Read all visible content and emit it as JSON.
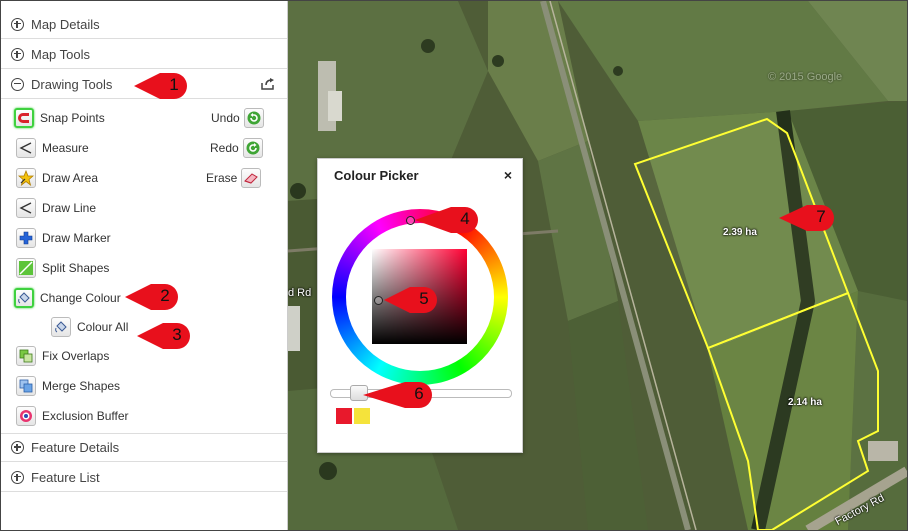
{
  "sidebar": {
    "sections": {
      "map_details": "Map Details",
      "map_tools": "Map Tools",
      "drawing_tools": "Drawing Tools",
      "feature_details": "Feature Details",
      "feature_list": "Feature List"
    },
    "tools": {
      "snap_points": "Snap Points",
      "measure": "Measure",
      "draw_area": "Draw Area",
      "draw_line": "Draw Line",
      "draw_marker": "Draw Marker",
      "split_shapes": "Split Shapes",
      "change_colour": "Change Colour",
      "colour_all": "Colour All",
      "fix_overlaps": "Fix Overlaps",
      "merge_shapes": "Merge Shapes",
      "exclusion_buffer": "Exclusion Buffer",
      "undo": "Undo",
      "redo": "Redo",
      "erase": "Erase"
    }
  },
  "map": {
    "area_labels": [
      "2.39 ha",
      "2.14 ha"
    ],
    "road_labels": {
      "factory": "Factory Rd",
      "left": "d Rd"
    },
    "watermark": "© 2015 Google"
  },
  "picker": {
    "title": "Colour Picker",
    "close": "×",
    "slider_value": 0.12,
    "swatches": [
      "#e8192c",
      "#f5e33b"
    ]
  },
  "callouts": [
    "1",
    "2",
    "3",
    "4",
    "5",
    "6",
    "7"
  ],
  "colors": {
    "callout_red": "#e8101c",
    "highlight_green": "#3fd13f",
    "boundary_yellow": "#ffff33"
  }
}
